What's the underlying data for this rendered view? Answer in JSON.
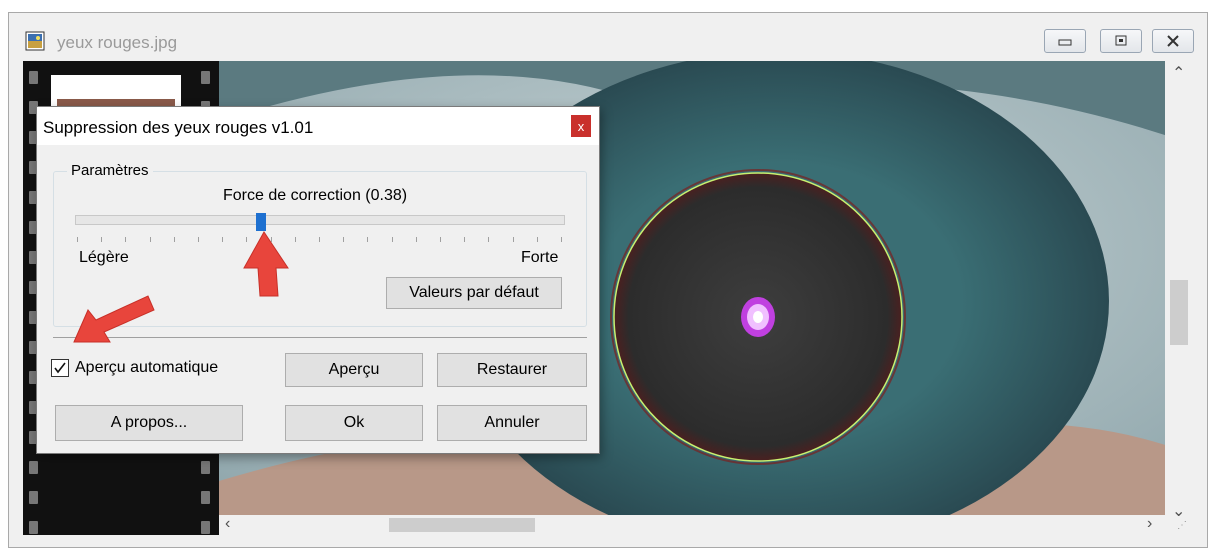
{
  "window": {
    "title": "yeux rouges.jpg"
  },
  "dialog": {
    "title": "Suppression des yeux rouges v1.01",
    "close_label": "x",
    "group_title": "Paramètres",
    "slider": {
      "label": "Force de correction (0.38)",
      "value": 0.38,
      "min_label": "Légère",
      "max_label": "Forte"
    },
    "defaults_button": "Valeurs par défaut",
    "auto_preview": {
      "label": "Aperçu automatique",
      "checked": true
    },
    "buttons": {
      "preview": "Aperçu",
      "restore": "Restaurer",
      "about": "A propos...",
      "ok": "Ok",
      "cancel": "Annuler"
    }
  },
  "colors": {
    "close_bg": "#c9302c",
    "slider_thumb": "#1e70d0",
    "arrow": "#e8453c",
    "iris": "#3a6e74",
    "highlight": "#e060ff"
  },
  "icons": [
    "image-file-icon",
    "minimize-icon",
    "maximize-icon",
    "close-icon",
    "scroll-up-icon",
    "scroll-down-icon",
    "scroll-left-icon",
    "scroll-right-icon",
    "checkmark-icon"
  ]
}
